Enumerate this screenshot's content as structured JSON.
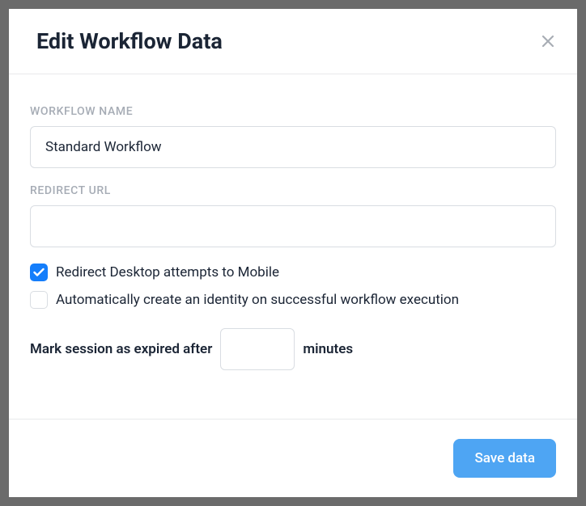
{
  "modal": {
    "title": "Edit Workflow Data"
  },
  "fields": {
    "workflow_name": {
      "label": "WORKFLOW NAME",
      "value": "Standard Workflow"
    },
    "redirect_url": {
      "label": "REDIRECT URL",
      "value": ""
    }
  },
  "checkboxes": {
    "redirect_desktop": {
      "label": "Redirect Desktop attempts to Mobile",
      "checked": true
    },
    "auto_identity": {
      "label": "Automatically create an identity on successful workflow execution",
      "checked": false
    }
  },
  "session": {
    "prefix": "Mark session as expired after",
    "value": "",
    "suffix": "minutes"
  },
  "footer": {
    "save_label": "Save data"
  }
}
